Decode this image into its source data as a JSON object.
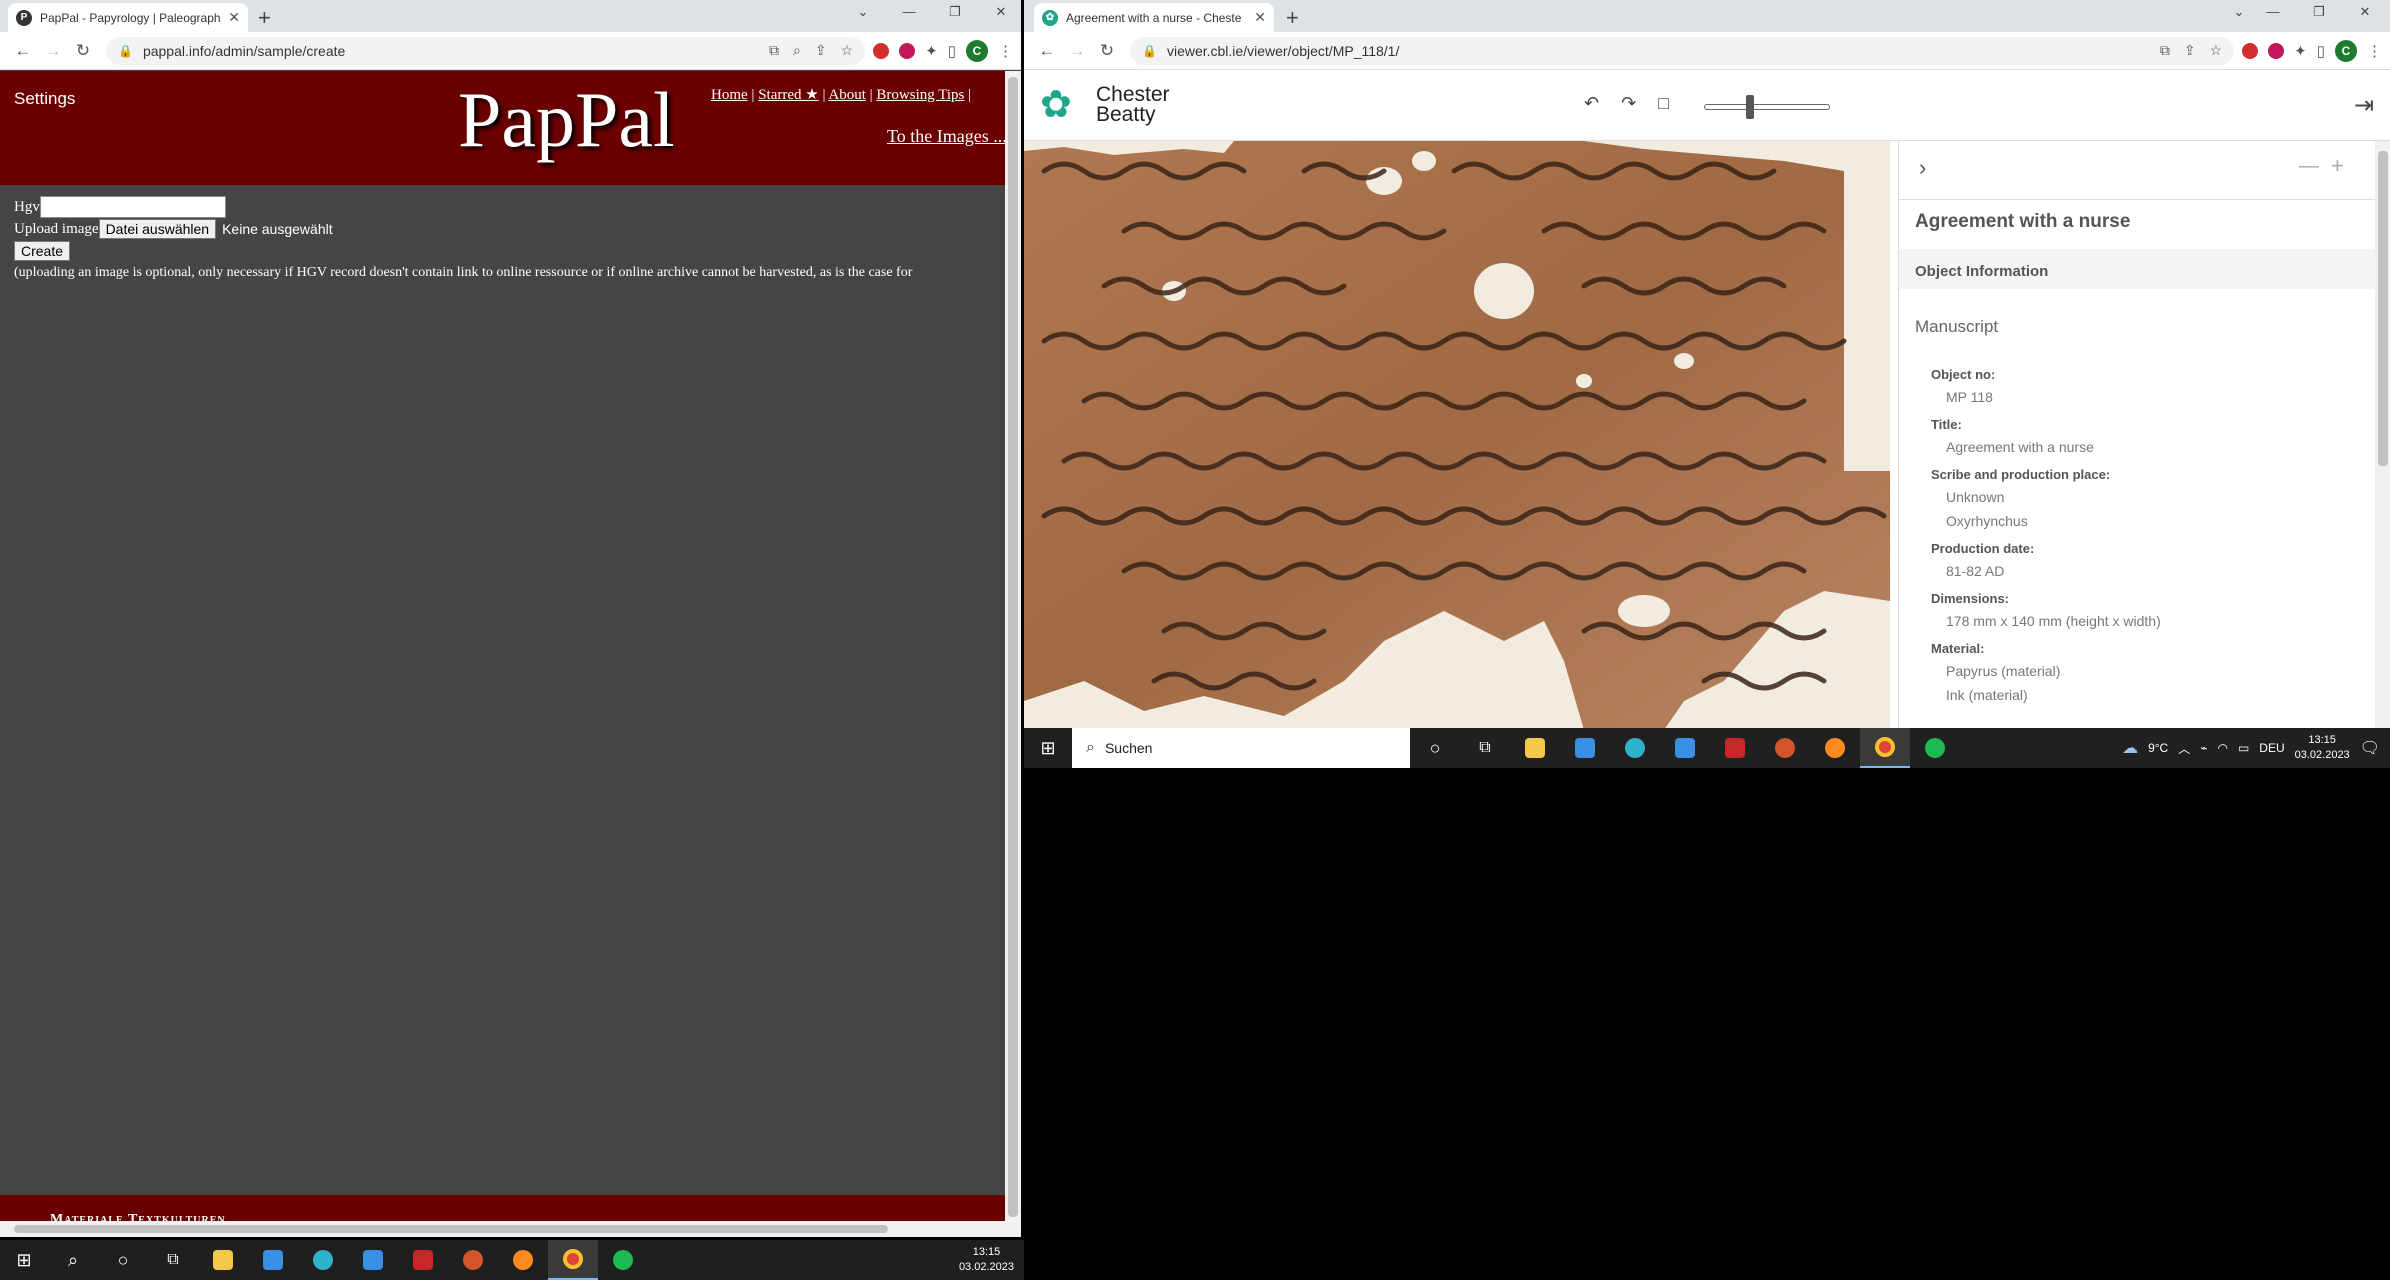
{
  "left_browser": {
    "tab_title": "PapPal - Papyrology | Paleograph",
    "url": "pappal.info/admin/sample/create",
    "profile_initial": "C",
    "page": {
      "settings": "Settings",
      "logo": "PapPal",
      "nav": [
        "Home",
        "Starred ★",
        "About",
        "Browsing Tips"
      ],
      "to_images": "To the Images ...",
      "hgv_label": "Hgv",
      "upload_label": "Upload image",
      "file_button": "Datei auswählen",
      "file_status": "Keine ausgewählt",
      "create_button": "Create",
      "upload_note": "(uploading an image is optional, only necessary if HGV record doesn't contain link to online ressource or if online archive cannot be harvested, as is the case for",
      "footer": "Materiale Textkulturen"
    }
  },
  "right_browser": {
    "tab_title": "Agreement with a nurse - Cheste",
    "url": "viewer.cbl.ie/viewer/object/MP_118/1/",
    "profile_initial": "C",
    "logo_line1": "Chester",
    "logo_line2": "Beatty",
    "zoom_fraction": 0.35,
    "panel": {
      "title": "Agreement with a nurse",
      "tab": "Object Information",
      "section": "Manuscript",
      "fields": [
        {
          "label": "Object no:",
          "values": [
            "MP 118"
          ]
        },
        {
          "label": "Title:",
          "values": [
            "Agreement with a nurse"
          ]
        },
        {
          "label": "Scribe and production place:",
          "values": [
            "Unknown",
            "Oxyrhynchus"
          ]
        },
        {
          "label": "Production date:",
          "values": [
            "81-82 AD"
          ]
        },
        {
          "label": "Dimensions:",
          "values": [
            "178 mm x 140 mm (height x width)"
          ]
        },
        {
          "label": "Material:",
          "values": [
            "Papyrus (material)",
            "Ink (material)"
          ]
        }
      ]
    }
  },
  "taskbar": {
    "search_placeholder": "Suchen",
    "weather": "9°C",
    "language": "DEU",
    "time": "13:15",
    "date": "03.02.2023"
  }
}
